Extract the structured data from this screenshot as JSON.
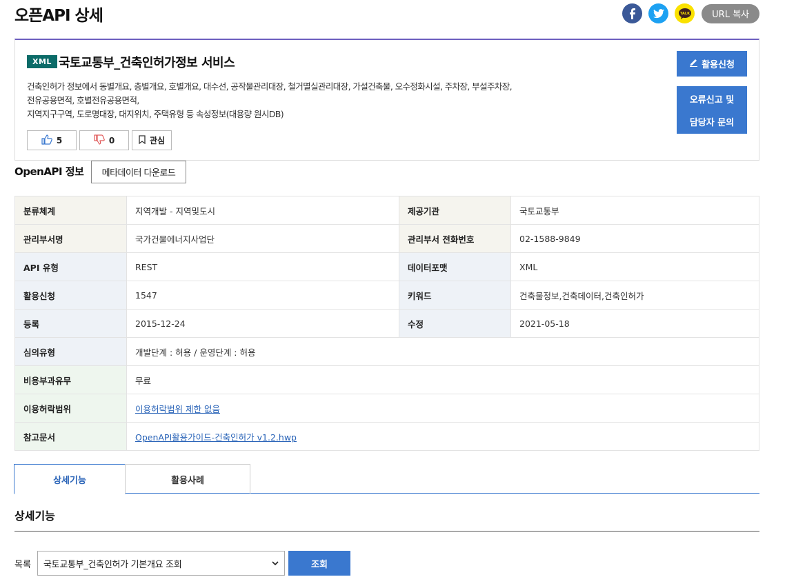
{
  "page": {
    "title": "오픈API 상세"
  },
  "share": {
    "url_copy_label": "URL 복사",
    "icons": [
      "facebook-icon",
      "twitter-icon",
      "kakaotalk-icon"
    ],
    "kakao_badge": "TALK"
  },
  "api": {
    "format_badge": "XML",
    "title": "국토교통부_건축인허가정보 서비스",
    "description_lines": [
      "건축인허가 정보에서 동별개요, 층별개요, 호별개요, 대수선, 공작물관리대장, 철거멸실관리대장, 가설건축물, 오수정화시설, 주차장, 부설주차장,",
      "전유공용면적, 호별전유공용면적,",
      "지역지구구역, 도로명대장, 대지위치, 주택유형 등 속성정보(대용량 원시DB)"
    ],
    "likes": "5",
    "dislikes": "0",
    "favorite_label": "관심",
    "apply_label": "활용신청",
    "report_label_1": "오류신고 및",
    "report_label_2": "담당자 문의"
  },
  "info": {
    "heading": "OpenAPI 정보",
    "metadata_download_label": "메타데이터 다운로드",
    "rows": [
      {
        "l1": "분류체계",
        "v1": "지역개발 - 지역및도시",
        "l2": "제공기관",
        "v2": "국토교통부"
      },
      {
        "l1": "관리부서명",
        "v1": "국가건물에너지사업단",
        "l2": "관리부서 전화번호",
        "v2": "02-1588-9849"
      },
      {
        "l1": "API 유형",
        "v1": "REST",
        "l2": "데이터포맷",
        "v2": "XML"
      },
      {
        "l1": "활용신청",
        "v1": "1547",
        "l2": "키워드",
        "v2": "건축물정보,건축데이터,건축인허가"
      },
      {
        "l1": "등록",
        "v1": "2015-12-24",
        "l2": "수정",
        "v2": "2021-05-18"
      }
    ],
    "review_type": {
      "label": "심의유형",
      "value": "개발단계 : 허용 / 운영단계 : 허용"
    },
    "fee": {
      "label": "비용부과유무",
      "value": "무료"
    },
    "license": {
      "label": "이용허락범위",
      "value": "이용허락범위 제한 없음"
    },
    "reference": {
      "label": "참고문서",
      "value": "OpenAPI활용가이드-건축인허가 v1.2.hwp"
    }
  },
  "tabs": {
    "detail": "상세기능",
    "cases": "활용사례"
  },
  "detail": {
    "section_title": "상세기능",
    "list_label": "목록",
    "selected_operation": "국토교통부_건축인허가 기본개요 조회",
    "query_label": "조회"
  },
  "colors": {
    "accent_blue": "#3a78cf",
    "badge_green": "#0b6b68",
    "top_border_purple": "#6e5fbf"
  }
}
